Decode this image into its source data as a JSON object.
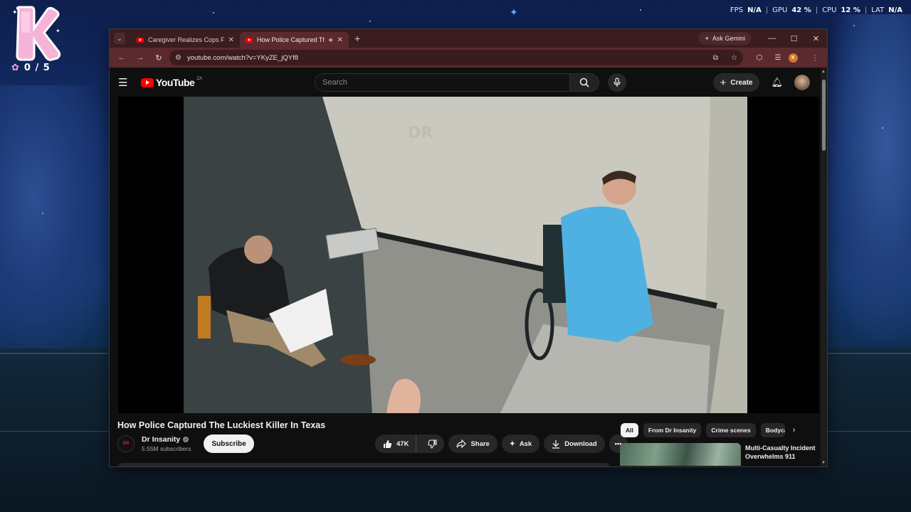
{
  "desktop": {
    "widget_counter": "0 / 5",
    "hud": {
      "fps_label": "FPS",
      "fps_value": "N/A",
      "gpu_label": "GPU",
      "gpu_value": "42 %",
      "cpu_label": "CPU",
      "cpu_value": "12 %",
      "lat_label": "LAT",
      "lat_value": "N/A"
    }
  },
  "browser": {
    "tabs": [
      {
        "title": "Caregiver Realizes Cops Found",
        "active": false
      },
      {
        "title": "How Police Captured The Luckiest",
        "active": true
      }
    ],
    "ask_gemini": "Ask Gemini",
    "profile_initial": "K",
    "url": "youtube.com/watch?v=YKyZE_jQYf8"
  },
  "youtube": {
    "logo_text": "YouTube",
    "logo_country": "ZA",
    "search_placeholder": "Search",
    "create_label": "Create",
    "video": {
      "title": "How Police Captured The Luckiest Killer In Texas",
      "watermark": "DR"
    },
    "channel": {
      "name": "Dr Insanity",
      "subscribers": "5.55M subscribers",
      "subscribe_label": "Subscribe",
      "avatar_text": "DR"
    },
    "actions": {
      "likes": "47K",
      "share": "Share",
      "ask": "Ask",
      "download": "Download"
    },
    "chips": [
      "All",
      "From Dr Insanity",
      "Crime scenes",
      "Bodycam"
    ],
    "recommendation": {
      "title": "Multi-Casualty Incident Overwhelms 911"
    }
  }
}
